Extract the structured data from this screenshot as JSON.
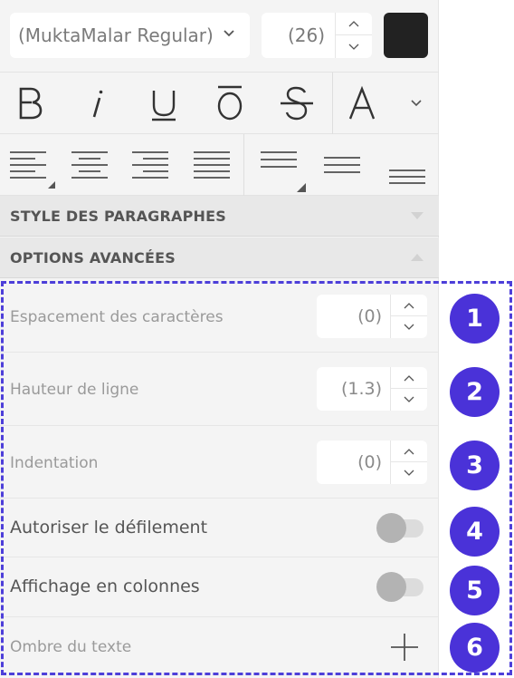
{
  "toolbar": {
    "font_name": "(MuktaMalar Regular)",
    "font_size": "(26)",
    "text_color": "#222222",
    "style_buttons": [
      {
        "name": "bold",
        "glyph": "B"
      },
      {
        "name": "italic",
        "glyph": "I"
      },
      {
        "name": "underline",
        "glyph": "U"
      },
      {
        "name": "overline",
        "glyph": "O"
      },
      {
        "name": "strikethrough",
        "glyph": "S"
      },
      {
        "name": "text-case",
        "glyph": "A"
      }
    ]
  },
  "sections": {
    "paragraph_styles": "STYLE DES PARAGRAPHES",
    "advanced_options": "OPTIONS AVANCÉES"
  },
  "advanced": {
    "letter_spacing": {
      "label": "Espacement des caractères",
      "value": "(0)"
    },
    "line_height": {
      "label": "Hauteur de ligne",
      "value": "(1.3)"
    },
    "indentation": {
      "label": "Indentation",
      "value": "(0)"
    },
    "allow_scroll": {
      "label": "Autoriser le défilement",
      "enabled": false
    },
    "columns_display": {
      "label": "Affichage en colonnes",
      "enabled": false
    },
    "text_shadow": {
      "label": "Ombre du texte"
    }
  },
  "badges": [
    "1",
    "2",
    "3",
    "4",
    "5",
    "6"
  ],
  "colors": {
    "accent": "#4a32d8",
    "panel": "#f4f4f4",
    "section": "#e8e8e8"
  }
}
